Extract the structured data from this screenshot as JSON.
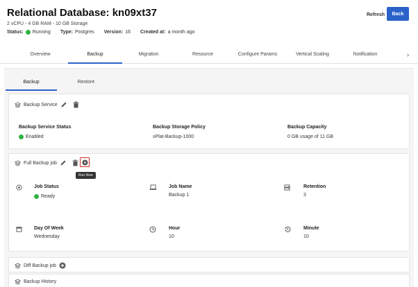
{
  "header": {
    "title": "Relational Database: kn09xt37",
    "specs": "2 vCPU - 4 GB RAM - 10 GB Storage",
    "status_label": "Status:",
    "status_value": "Running",
    "type_label": "Type:",
    "type_value": "Postgres",
    "version_label": "Version:",
    "version_value": "16",
    "created_label": "Created at:",
    "created_value": "a month ago",
    "refresh_label": "Refresh",
    "back_label": "Back"
  },
  "tabs": [
    {
      "label": "Overview"
    },
    {
      "label": "Backup"
    },
    {
      "label": "Migration"
    },
    {
      "label": "Resource"
    },
    {
      "label": "Configure Params"
    },
    {
      "label": "Vertical Scaling"
    },
    {
      "label": "Notification"
    }
  ],
  "subtabs": [
    {
      "label": "Backup"
    },
    {
      "label": "Restore"
    }
  ],
  "backup_service": {
    "title": "Backup Service",
    "status_label": "Backup Service Status",
    "status_value": "Enabled",
    "policy_label": "Backup Storage Policy",
    "policy_value": "xPlat-Backup-1000",
    "capacity_label": "Backup Capacity",
    "capacity_value": "0 GB usage of 11 GB"
  },
  "full_backup": {
    "title": "Full Backup job",
    "tooltip": "Run Now",
    "job_status_label": "Job Status",
    "job_status_value": "Ready",
    "job_name_label": "Job Name",
    "job_name_value": "Backup 1",
    "retention_label": "Retention",
    "retention_value": "3",
    "day_label": "Day Of Week",
    "day_value": "Wednesday",
    "hour_label": "Hour",
    "hour_value": "10",
    "minute_label": "Minute",
    "minute_value": "10"
  },
  "diff_backup": {
    "title": "Diff Backup job"
  },
  "history": {
    "title": "Backup History"
  },
  "colors": {
    "accent": "#2a62c9",
    "success": "#2fb344",
    "highlight": "#d12a2a"
  },
  "icons": [
    "layers-icon",
    "pencil-icon",
    "trash-icon",
    "play-circle-icon",
    "plus-circle-icon",
    "target-icon",
    "laptop-icon",
    "server-icon",
    "calendar-icon",
    "clock-icon",
    "history-icon",
    "chevron-right-icon"
  ]
}
